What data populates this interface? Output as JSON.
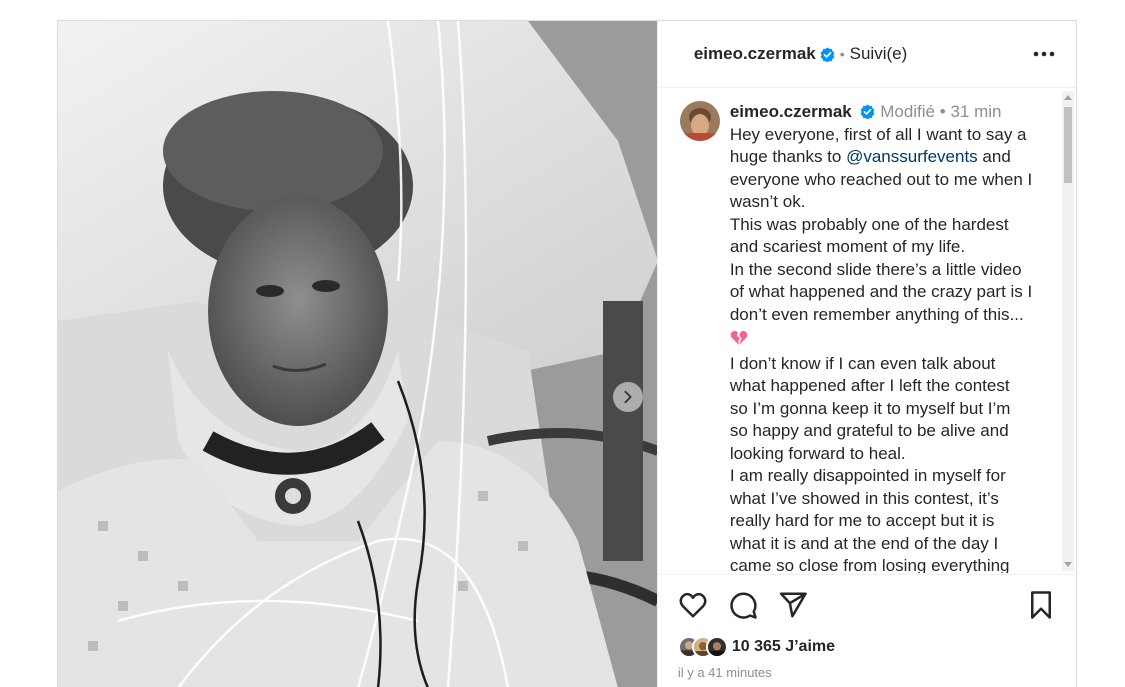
{
  "post": {
    "author": "eimeo.czermak",
    "follow_status": "Suivi(e)",
    "separator": "•"
  },
  "caption": {
    "author": "eimeo.czermak",
    "edited": "Modifié",
    "time": "31 min",
    "lines": [
      "Hey everyone, first of all I want to say a",
      "huge thanks to ",
      "@vanssurfevents",
      " and",
      "everyone who reached out to me when I",
      "wasn’t ok.",
      "This was probably one of the hardest",
      "and scariest moment of my life.",
      "In the second slide there’s a little video",
      "of what happened and the crazy part is I",
      "don’t even remember anything of this...",
      "I don’t know if I can even talk about",
      "what happened after I left the contest",
      "so I’m gonna keep it to myself but I’m",
      "so happy and grateful to be alive and",
      "looking forward to heal.",
      "I am really disappointed in myself for",
      "what I’ve showed in this contest, it’s",
      "really hard for me to accept but it is",
      "what it is and at the end of the day I",
      "came so close from losing everything"
    ]
  },
  "engagement": {
    "likes": "10 365 J’aime",
    "posted_ago": "il y a 41 minutes"
  },
  "icons": {
    "verified": "verified-badge-icon",
    "more": "more-horizontal-icon",
    "like": "heart-outline-icon",
    "comment": "comment-icon",
    "share": "send-icon",
    "save": "bookmark-icon",
    "next": "chevron-right-icon",
    "broken_heart": "broken-heart-emoji"
  },
  "colors": {
    "verified_blue": "#0095f6",
    "mention": "#00376b",
    "secondary_text": "#8e8e8e",
    "broken_heart": "#f4638e"
  }
}
